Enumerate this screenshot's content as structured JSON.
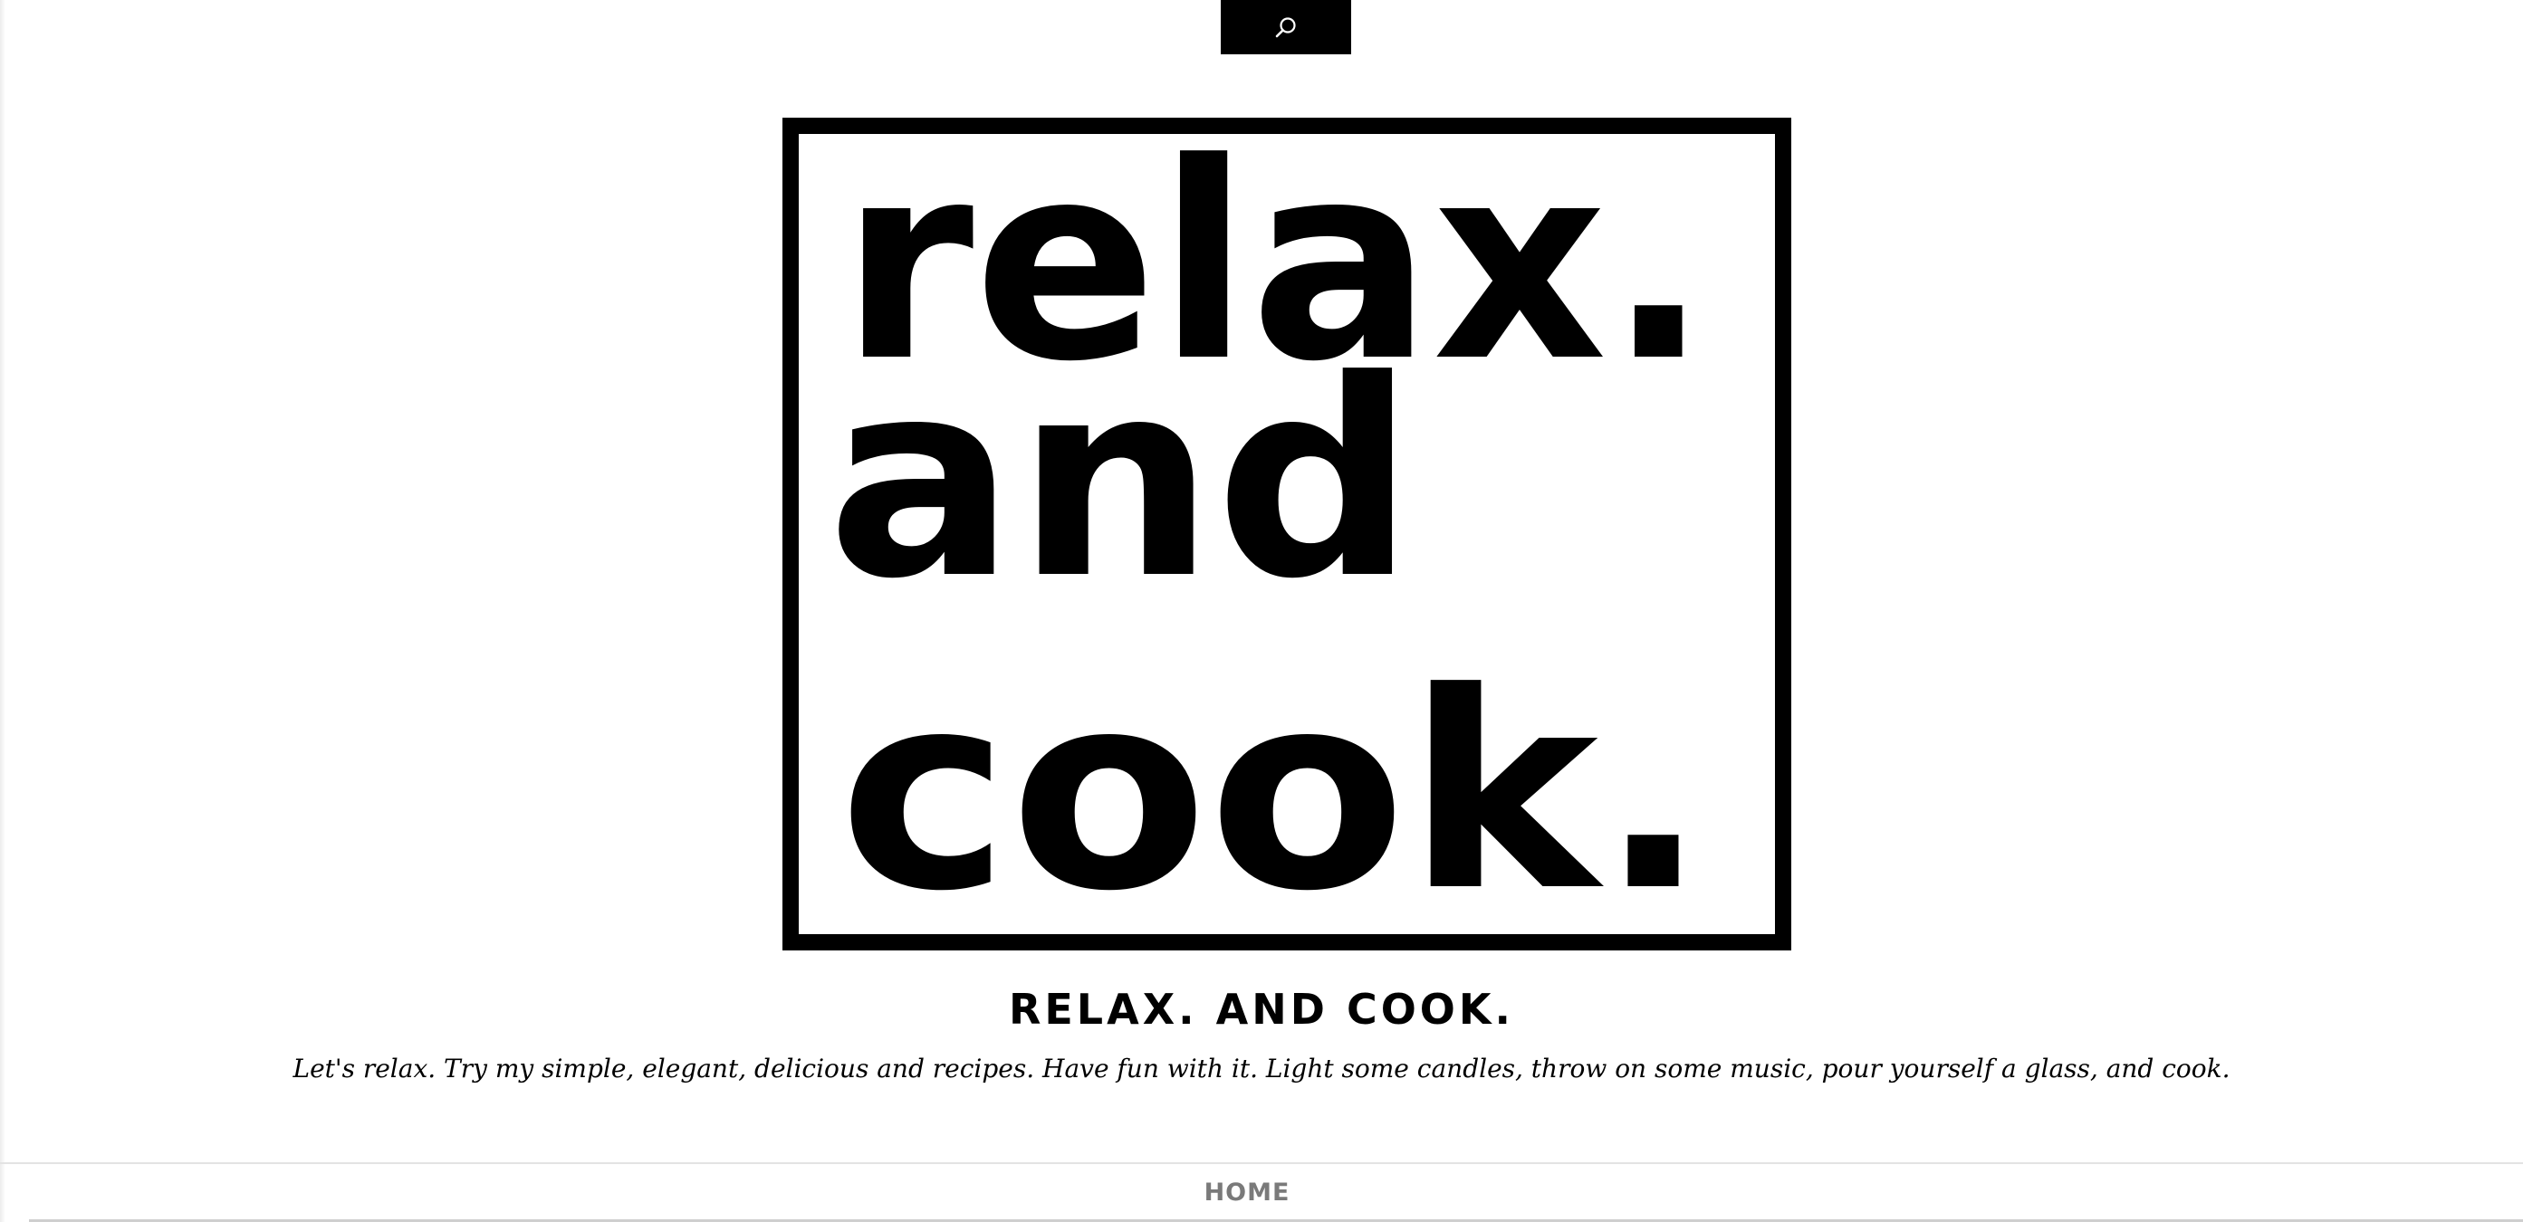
{
  "header": {
    "search_icon": "search-icon",
    "logo_lines": [
      "relax.",
      "and",
      "cook."
    ],
    "title": "RELAX. AND COOK.",
    "tagline": "Let's relax. Try my simple, elegant, delicious and recipes. Have fun with it. Light some candles, throw on some music, pour yourself a glass, and cook."
  },
  "nav": {
    "items": [
      {
        "label": "HOME"
      }
    ]
  },
  "colors": {
    "background": "#ffffff",
    "ink": "#000000",
    "nav_text": "#7a7a7a",
    "divider": "#e3e3e3"
  }
}
